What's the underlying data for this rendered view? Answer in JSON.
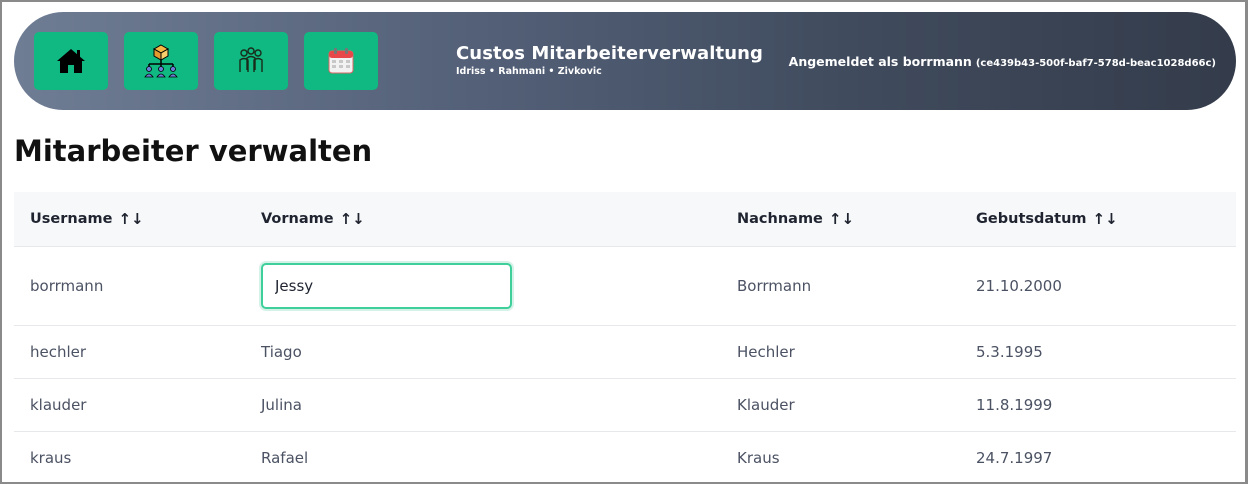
{
  "nav": {
    "buttons": [
      {
        "icon": "home-icon"
      },
      {
        "icon": "organization-icon"
      },
      {
        "icon": "employees-icon"
      },
      {
        "icon": "calendar-icon"
      }
    ],
    "accent": "#10b981"
  },
  "header": {
    "title": "Custos Mitarbeiterverwaltung",
    "subtitle": "Idriss • Rahmani • Zivkovic",
    "login_label": "Angemeldet als borrmann",
    "login_uid": "(ce439b43-500f-baf7-578d-beac1028d66c)"
  },
  "page": {
    "title": "Mitarbeiter verwalten"
  },
  "table": {
    "columns": [
      "Username",
      "Vorname",
      "Nachname",
      "Gebutsdatum"
    ],
    "sort_symbol": "↑↓",
    "rows": [
      {
        "username": "borrmann",
        "vorname": "Jessy",
        "nachname": "Borrmann",
        "geburtsdatum": "21.10.2000"
      },
      {
        "username": "hechler",
        "vorname": "Tiago",
        "nachname": "Hechler",
        "geburtsdatum": "5.3.1995"
      },
      {
        "username": "klauder",
        "vorname": "Julina",
        "nachname": "Klauder",
        "geburtsdatum": "11.8.1999"
      },
      {
        "username": "kraus",
        "vorname": "Rafael",
        "nachname": "Kraus",
        "geburtsdatum": "24.7.1997"
      }
    ]
  }
}
